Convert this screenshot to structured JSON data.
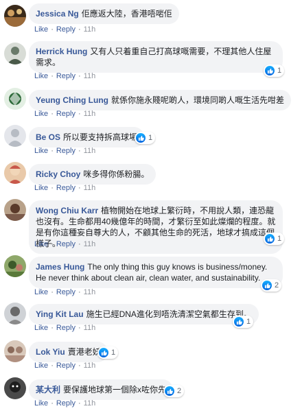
{
  "actions": {
    "like_label": "Like",
    "reply_label": "Reply",
    "separator": "·"
  },
  "comments": [
    {
      "author": "Jessica Ng",
      "text": "佢應返大陸，香港唔啱佢",
      "time": "11h",
      "reactions": "",
      "avatar_color": "#9b6b3a",
      "avatar_bg": "#3a2a1a"
    },
    {
      "author": "Herrick Hung",
      "text": "又有人只着重自己打高球嘅需要，不理其他人住屋需求。",
      "time": "11h",
      "reactions": "1",
      "avatar_color": "#6a7a6a",
      "avatar_bg": "#d8dcd6"
    },
    {
      "author": "Yeung Ching Lung",
      "text": "就係你施永賤呢啲人，環境同啲人嘅生活先咁差",
      "time": "11h",
      "reactions": "",
      "avatar_color": "#2e6b3a",
      "avatar_bg": "#e3efe3"
    },
    {
      "author": "Be OS",
      "text": "所以要支持拆高球場",
      "time": "11h",
      "reactions": "1",
      "avatar_color": "#b7bcc4",
      "avatar_bg": "#e4e6eb"
    },
    {
      "author": "Ricky Choy",
      "text": "咪多得你係粉腸。",
      "time": "11h",
      "reactions": "",
      "avatar_color": "#c8584a",
      "avatar_bg": "#e9c9a9"
    },
    {
      "author": "Wong Chiu Karr",
      "text": "植物開始在地球上繁衍時，不用說人類，連恐龍也沒有。生命都用40幾億年的時間，才繁衍至如此燦爛的程度。就是有你這種妄自尊大的人，不顧其他生命的死活，地球才搞成這個樣子。",
      "time": "11h",
      "reactions": "1",
      "avatar_color": "#5a3a2a",
      "avatar_bg": "#b9a28a"
    },
    {
      "author": "James Hung",
      "text": "The only thing this guy knows is business/money. He never think about clean air, clean water, and sustainability.",
      "time": "11h",
      "reactions": "2",
      "avatar_color": "#3d5a2a",
      "avatar_bg": "#8fa86a"
    },
    {
      "author": "Ying Kit Lau",
      "text": "施生已經DNA進化到唔洗清潔空氣都生存到。",
      "time": "11h",
      "reactions": "1",
      "avatar_color": "#6a6a6a",
      "avatar_bg": "#cfd2d6"
    },
    {
      "author": "Lok Yiu",
      "text": "賣港老妖",
      "time": "11h",
      "reactions": "1",
      "avatar_color": "#8a6a5a",
      "avatar_bg": "#d9c9bb"
    },
    {
      "author": "某大利",
      "text": "要保護地球第一個除x咗你先",
      "time": "11h",
      "reactions": "2",
      "avatar_color": "#1e1e1e",
      "avatar_bg": "#4a4a4a"
    }
  ]
}
